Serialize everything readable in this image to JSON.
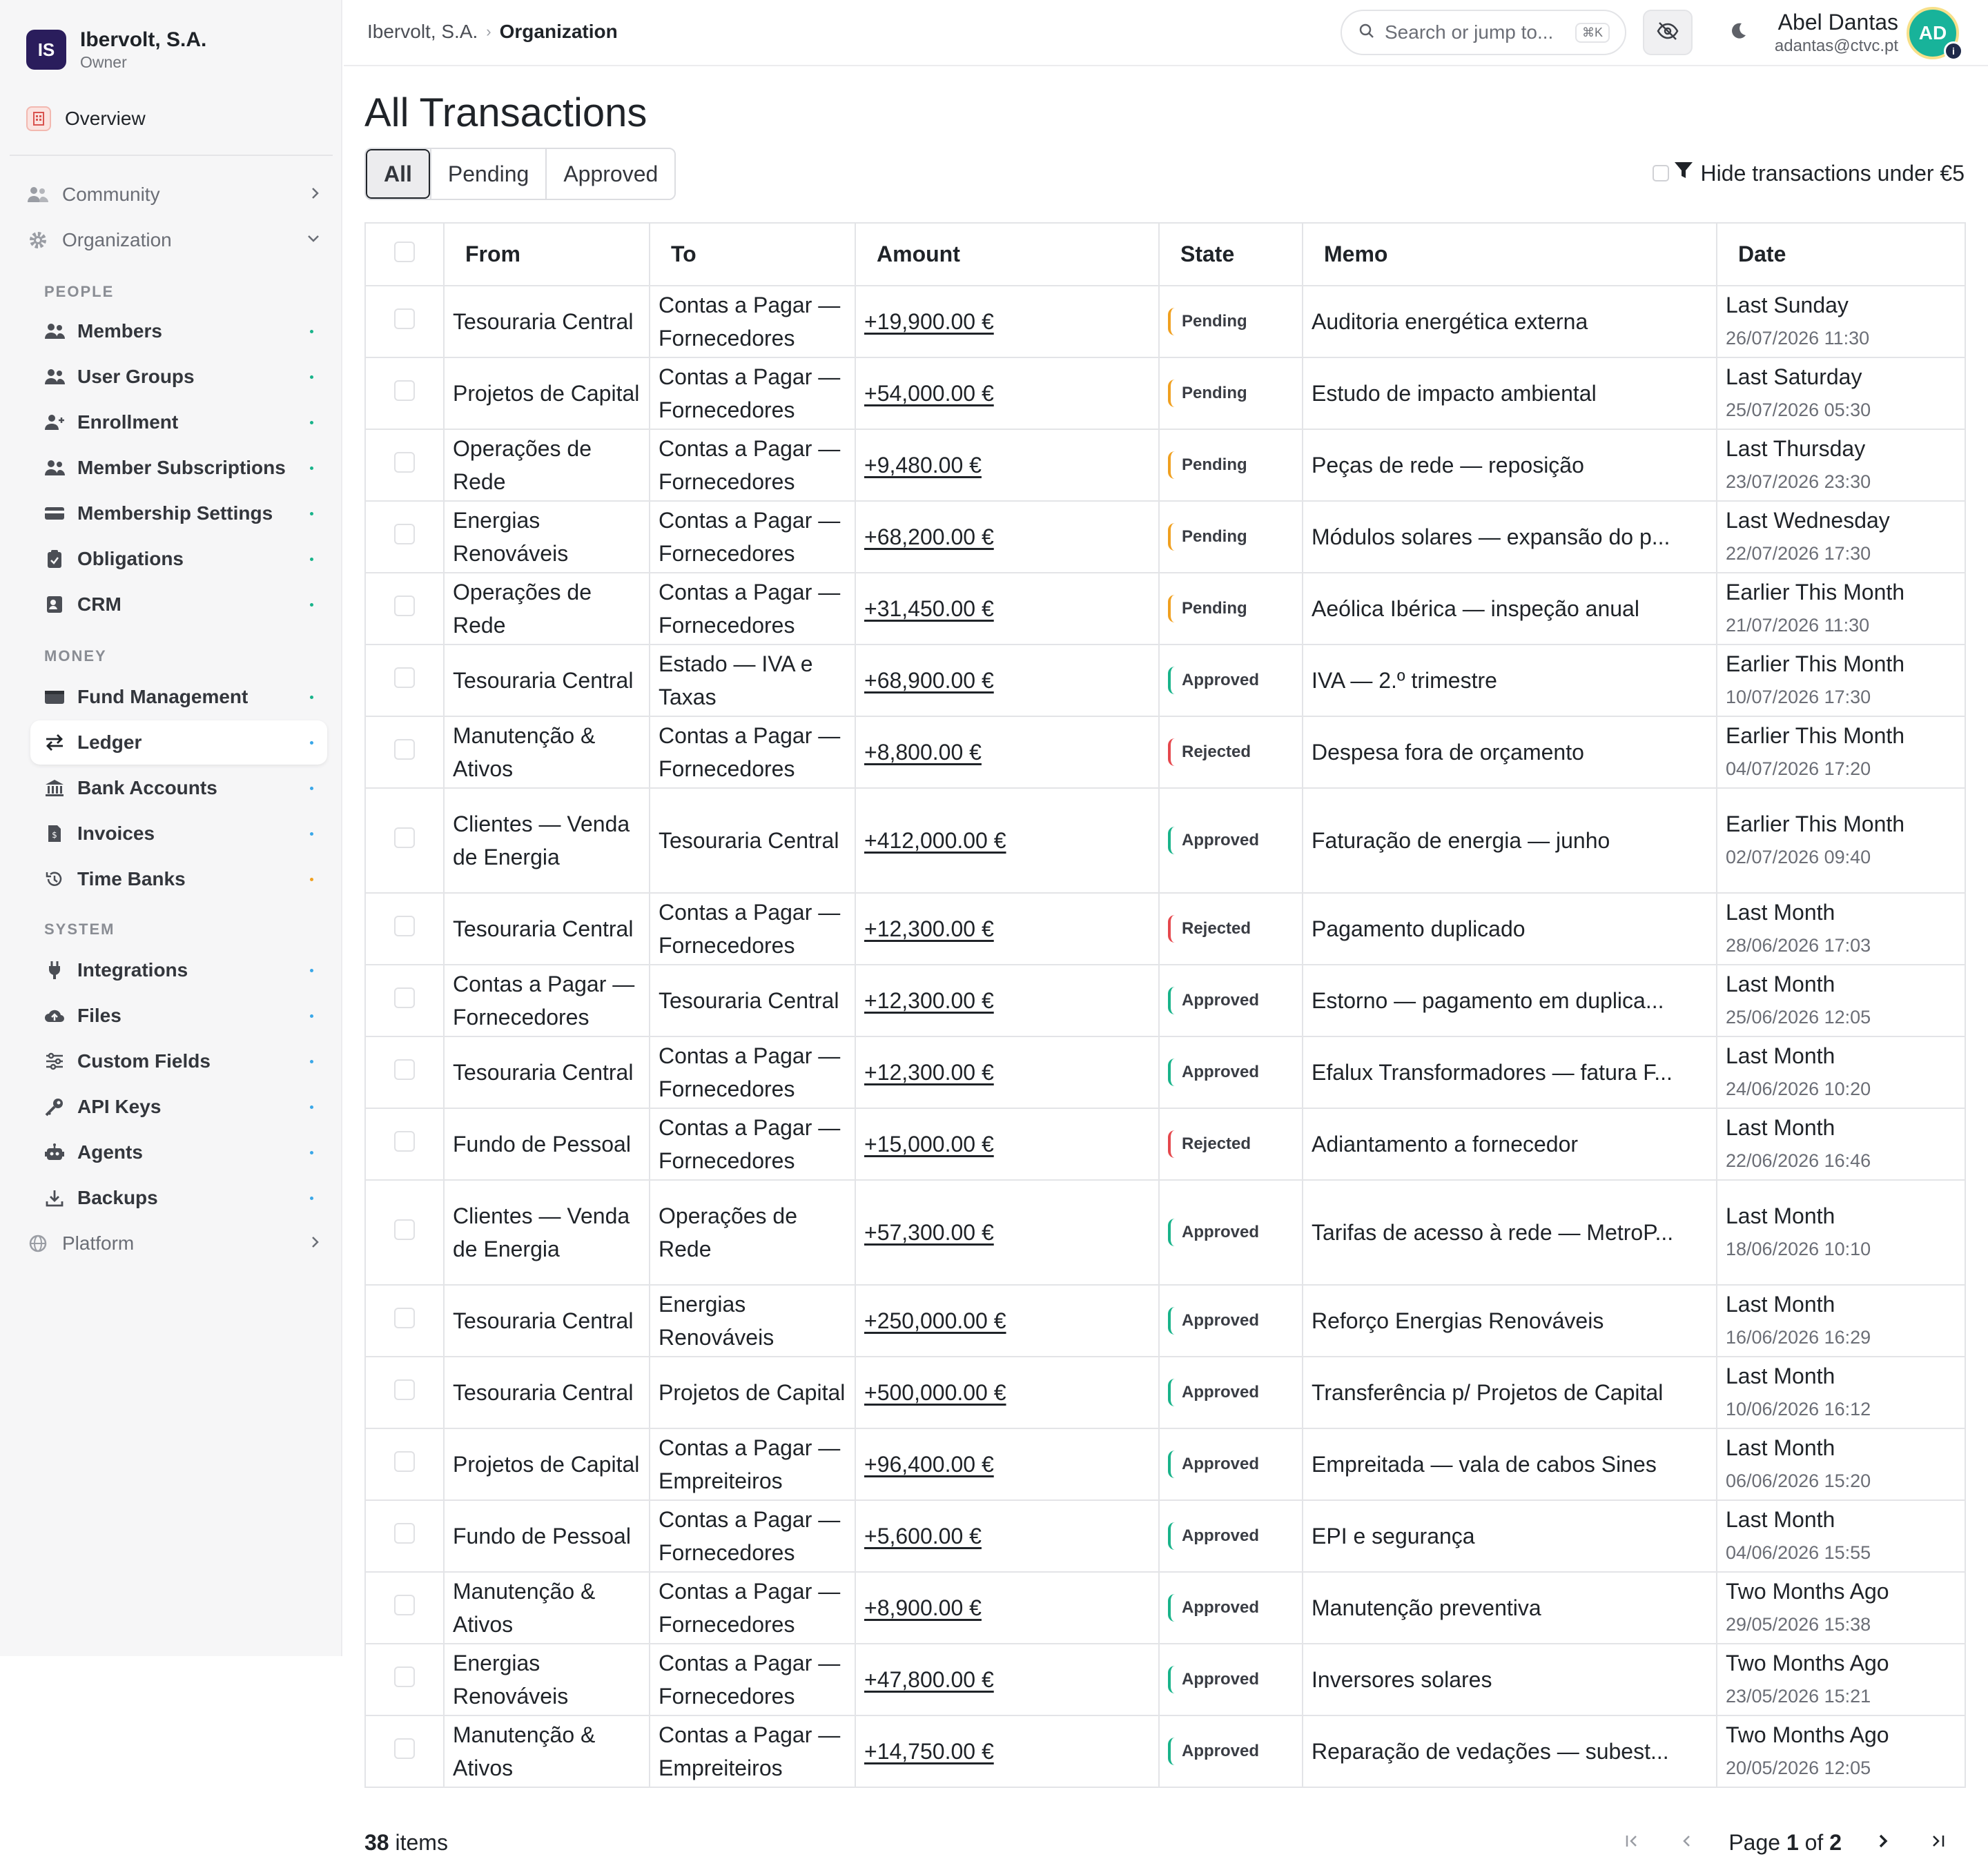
{
  "org": {
    "initials": "IS",
    "name": "Ibervolt, S.A.",
    "role": "Owner"
  },
  "sidebar": {
    "overview": "Overview",
    "community": "Community",
    "organization": "Organization",
    "platform": "Platform",
    "sections": {
      "people": "PEOPLE",
      "money": "MONEY",
      "system": "SYSTEM"
    },
    "people": [
      {
        "label": "Members",
        "dot": "#19b38a"
      },
      {
        "label": "User Groups",
        "dot": "#19b38a"
      },
      {
        "label": "Enrollment",
        "dot": "#19b38a"
      },
      {
        "label": "Member Subscriptions",
        "dot": "#19b38a"
      },
      {
        "label": "Membership Settings",
        "dot": "#19b38a"
      },
      {
        "label": "Obligations",
        "dot": "#19b38a"
      },
      {
        "label": "CRM",
        "dot": "#19b38a"
      }
    ],
    "money": [
      {
        "label": "Fund Management",
        "dot": "#19b38a"
      },
      {
        "label": "Ledger",
        "dot": "#3aa7e8"
      },
      {
        "label": "Bank Accounts",
        "dot": "#3aa7e8"
      },
      {
        "label": "Invoices",
        "dot": "#3aa7e8"
      },
      {
        "label": "Time Banks",
        "dot": "#f0a020"
      }
    ],
    "system": [
      {
        "label": "Integrations",
        "dot": "#3aa7e8"
      },
      {
        "label": "Files",
        "dot": "#3aa7e8"
      },
      {
        "label": "Custom Fields",
        "dot": "#3aa7e8"
      },
      {
        "label": "API Keys",
        "dot": "#3aa7e8"
      },
      {
        "label": "Agents",
        "dot": "#3aa7e8"
      },
      {
        "label": "Backups",
        "dot": "#3aa7e8"
      }
    ]
  },
  "header": {
    "breadcrumb": [
      "Ibervolt, S.A.",
      "Organization"
    ],
    "search_placeholder": "Search or jump to...",
    "search_shortcut": "⌘K",
    "user_name": "Abel Dantas",
    "user_email": "adantas@ctvc.pt",
    "avatar_initials": "AD",
    "avatar_badge": "i"
  },
  "page": {
    "title": "All Transactions",
    "tabs": [
      "All",
      "Pending",
      "Approved"
    ],
    "active_tab": "All",
    "hide_filter_label": "Hide transactions under €5"
  },
  "table": {
    "columns": [
      "From",
      "To",
      "Amount",
      "State",
      "Memo",
      "Date"
    ],
    "rows": [
      {
        "from": "Tesouraria Central",
        "to": "Contas a Pagar — Fornecedores",
        "amount": "+19,900.00 €",
        "state": "Pending",
        "memo": "Auditoria energética externa",
        "date_rel": "Last Sunday",
        "date_abs": "26/07/2026 11:30"
      },
      {
        "from": "Projetos de Capital",
        "to": "Contas a Pagar — Fornecedores",
        "amount": "+54,000.00 €",
        "state": "Pending",
        "memo": "Estudo de impacto ambiental",
        "date_rel": "Last Saturday",
        "date_abs": "25/07/2026 05:30"
      },
      {
        "from": "Operações de Rede",
        "to": "Contas a Pagar — Fornecedores",
        "amount": "+9,480.00 €",
        "state": "Pending",
        "memo": "Peças de rede — reposição",
        "date_rel": "Last Thursday",
        "date_abs": "23/07/2026 23:30"
      },
      {
        "from": "Energias Renováveis",
        "to": "Contas a Pagar — Fornecedores",
        "amount": "+68,200.00 €",
        "state": "Pending",
        "memo": "Módulos solares — expansão do p...",
        "date_rel": "Last Wednesday",
        "date_abs": "22/07/2026 17:30"
      },
      {
        "from": "Operações de Rede",
        "to": "Contas a Pagar — Fornecedores",
        "amount": "+31,450.00 €",
        "state": "Pending",
        "memo": "Aeólica Ibérica — inspeção anual",
        "date_rel": "Earlier This Month",
        "date_abs": "21/07/2026 11:30"
      },
      {
        "from": "Tesouraria Central",
        "to": "Estado — IVA e Taxas",
        "amount": "+68,900.00 €",
        "state": "Approved",
        "memo": "IVA — 2.º trimestre",
        "date_rel": "Earlier This Month",
        "date_abs": "10/07/2026 17:30"
      },
      {
        "from": "Manutenção & Ativos",
        "to": "Contas a Pagar — Fornecedores",
        "amount": "+8,800.00 €",
        "state": "Rejected",
        "memo": "Despesa fora de orçamento",
        "date_rel": "Earlier This Month",
        "date_abs": "04/07/2026 17:20"
      },
      {
        "from": "Clientes — Venda de Energia",
        "to": "Tesouraria Central",
        "amount": "+412,000.00 €",
        "state": "Approved",
        "memo": "Faturação de energia — junho",
        "date_rel": "Earlier This Month",
        "date_abs": "02/07/2026 09:40"
      },
      {
        "from": "Tesouraria Central",
        "to": "Contas a Pagar — Fornecedores",
        "amount": "+12,300.00 €",
        "state": "Rejected",
        "memo": "Pagamento duplicado",
        "date_rel": "Last Month",
        "date_abs": "28/06/2026 17:03"
      },
      {
        "from": "Contas a Pagar — Fornecedores",
        "to": "Tesouraria Central",
        "amount": "+12,300.00 €",
        "state": "Approved",
        "memo": "Estorno — pagamento em duplica...",
        "date_rel": "Last Month",
        "date_abs": "25/06/2026 12:05"
      },
      {
        "from": "Tesouraria Central",
        "to": "Contas a Pagar — Fornecedores",
        "amount": "+12,300.00 €",
        "state": "Approved",
        "memo": "Efalux Transformadores — fatura F...",
        "date_rel": "Last Month",
        "date_abs": "24/06/2026 10:20"
      },
      {
        "from": "Fundo de Pessoal",
        "to": "Contas a Pagar — Fornecedores",
        "amount": "+15,000.00 €",
        "state": "Rejected",
        "memo": "Adiantamento a fornecedor",
        "date_rel": "Last Month",
        "date_abs": "22/06/2026 16:46"
      },
      {
        "from": "Clientes — Venda de Energia",
        "to": "Operações de Rede",
        "amount": "+57,300.00 €",
        "state": "Approved",
        "memo": "Tarifas de acesso à rede — MetroP...",
        "date_rel": "Last Month",
        "date_abs": "18/06/2026 10:10"
      },
      {
        "from": "Tesouraria Central",
        "to": "Energias Renováveis",
        "amount": "+250,000.00 €",
        "state": "Approved",
        "memo": "Reforço Energias Renováveis",
        "date_rel": "Last Month",
        "date_abs": "16/06/2026 16:29"
      },
      {
        "from": "Tesouraria Central",
        "to": "Projetos de Capital",
        "amount": "+500,000.00 €",
        "state": "Approved",
        "memo": "Transferência p/ Projetos de Capital",
        "date_rel": "Last Month",
        "date_abs": "10/06/2026 16:12"
      },
      {
        "from": "Projetos de Capital",
        "to": "Contas a Pagar — Empreiteiros",
        "amount": "+96,400.00 €",
        "state": "Approved",
        "memo": "Empreitada — vala de cabos Sines",
        "date_rel": "Last Month",
        "date_abs": "06/06/2026 15:20"
      },
      {
        "from": "Fundo de Pessoal",
        "to": "Contas a Pagar — Fornecedores",
        "amount": "+5,600.00 €",
        "state": "Approved",
        "memo": "EPI e segurança",
        "date_rel": "Last Month",
        "date_abs": "04/06/2026 15:55"
      },
      {
        "from": "Manutenção & Ativos",
        "to": "Contas a Pagar — Fornecedores",
        "amount": "+8,900.00 €",
        "state": "Approved",
        "memo": "Manutenção preventiva",
        "date_rel": "Two Months Ago",
        "date_abs": "29/05/2026 15:38"
      },
      {
        "from": "Energias Renováveis",
        "to": "Contas a Pagar — Fornecedores",
        "amount": "+47,800.00 €",
        "state": "Approved",
        "memo": "Inversores solares",
        "date_rel": "Two Months Ago",
        "date_abs": "23/05/2026 15:21"
      },
      {
        "from": "Manutenção & Ativos",
        "to": "Contas a Pagar — Empreiteiros",
        "amount": "+14,750.00 €",
        "state": "Approved",
        "memo": "Reparação de vedações — subest...",
        "date_rel": "Two Months Ago",
        "date_abs": "20/05/2026 12:05"
      }
    ]
  },
  "state_colors": {
    "Pending": "#f0a020",
    "Approved": "#19b38a",
    "Rejected": "#e5484d"
  },
  "footer": {
    "count": "38",
    "count_suffix": "items",
    "page_prefix": "Page",
    "page_current": "1",
    "page_of": "of",
    "page_total": "2"
  }
}
